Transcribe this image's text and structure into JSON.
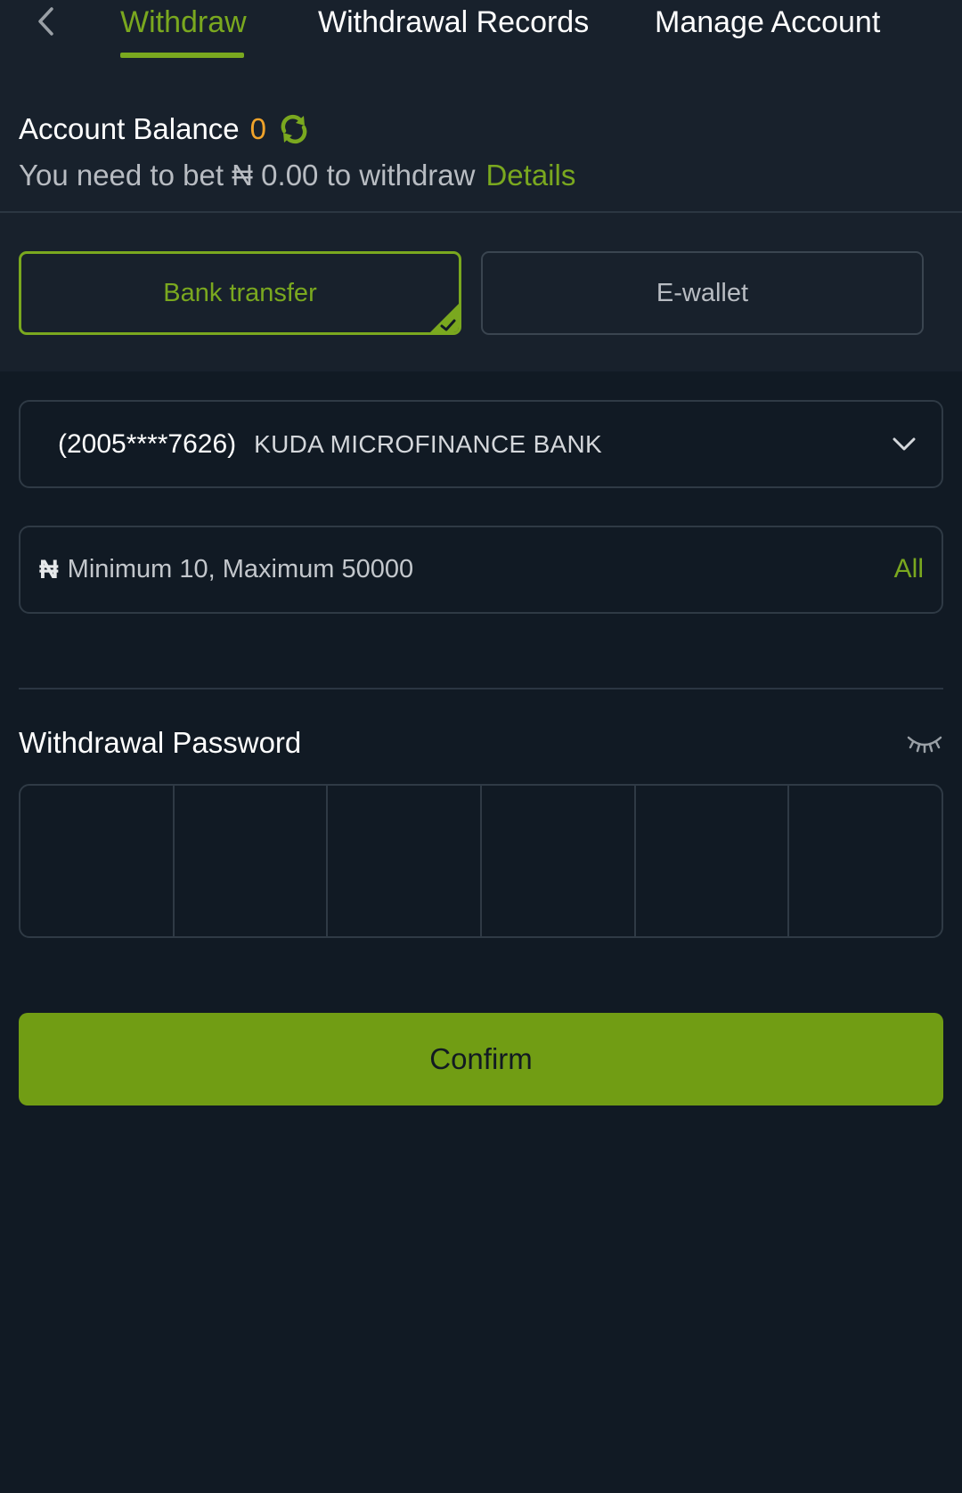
{
  "tabs": {
    "withdraw": "Withdraw",
    "records": "Withdrawal Records",
    "manage": "Manage Account",
    "active": "withdraw"
  },
  "balance": {
    "label": "Account Balance",
    "value": "0",
    "bet_text": "You need to bet ₦ 0.00 to withdraw",
    "details_label": "Details"
  },
  "methods": {
    "bank_transfer": "Bank transfer",
    "ewallet": "E-wallet",
    "selected": "bank_transfer"
  },
  "bank": {
    "account": "(2005****7626)",
    "name": "KUDA MICROFINANCE BANK"
  },
  "amount": {
    "currency_symbol": "₦",
    "placeholder": "Minimum 10, Maximum 50000",
    "value": "",
    "all_label": "All"
  },
  "password": {
    "label": "Withdrawal Password",
    "digits": [
      "",
      "",
      "",
      "",
      "",
      ""
    ]
  },
  "confirm_label": "Confirm",
  "colors": {
    "background": "#111a24",
    "panel": "#18212c",
    "accent": "#7aa81f",
    "button": "#719d14",
    "balance_value": "#f0a32a"
  },
  "icons": {
    "back": "chevron-left-icon",
    "refresh": "refresh-icon",
    "check": "check-icon",
    "dropdown": "chevron-down-icon",
    "eye": "eye-closed-icon"
  }
}
